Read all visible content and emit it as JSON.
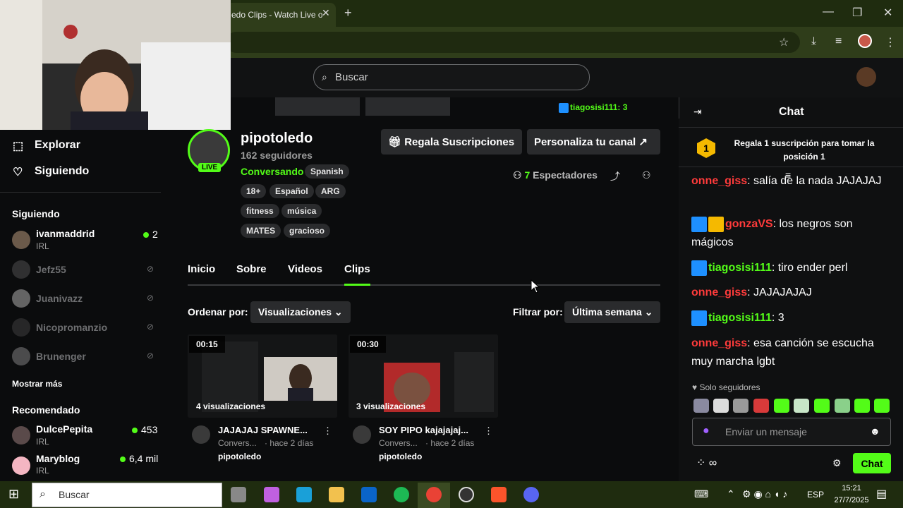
{
  "browser": {
    "tab_title": "edo Clips - Watch Live o",
    "close": "✕",
    "new_tab": "+",
    "minimize": "—",
    "maximize": "❐",
    "close_window": "✕"
  },
  "topbar": {
    "search_placeholder": "Buscar"
  },
  "sidebar": {
    "nav": [
      {
        "label": "Explorar"
      },
      {
        "label": "Siguiendo"
      }
    ],
    "following_heading": "Siguiendo",
    "following": [
      {
        "name": "ivanmaddrid",
        "category": "IRL",
        "viewers": "2",
        "live": true
      },
      {
        "name": "Jefz55",
        "live": false
      },
      {
        "name": "Juanivazz",
        "live": false
      },
      {
        "name": "Nicopromanzio",
        "live": false
      },
      {
        "name": "Brunenger",
        "live": false
      }
    ],
    "show_more": "Mostrar más",
    "recommended_heading": "Recomendado",
    "recommended": [
      {
        "name": "DulcePepita",
        "category": "IRL",
        "viewers": "453"
      },
      {
        "name": "Maryblog",
        "category": "IRL",
        "viewers": "6,4 mil"
      }
    ]
  },
  "channel": {
    "name": "pipotoledo",
    "followers": "162 seguidores",
    "live_badge": "LIVE",
    "category": "Conversando",
    "language": "Spanish",
    "tags": [
      "18+",
      "Español",
      "ARG",
      "fitness",
      "música",
      "MATES",
      "gracioso"
    ],
    "gift_button": "Regala Suscripciones",
    "customize_button": "Personaliza tu canal",
    "viewers_count": "7",
    "viewers_label": "Espectadores"
  },
  "tabs": [
    "Inicio",
    "Sobre",
    "Videos",
    "Clips"
  ],
  "filters": {
    "order_label": "Ordenar por:",
    "order_value": "Visualizaciones",
    "filter_label": "Filtrar por:",
    "filter_value": "Última semana"
  },
  "clips": [
    {
      "duration": "00:15",
      "views": "4 visualizaciones",
      "title": "JAJAJAJ SPAWNE...",
      "category": "Convers...",
      "age": "· hace 2 días",
      "channel": "pipotoledo"
    },
    {
      "duration": "00:30",
      "views": "3 visualizaciones",
      "title": "SOY PIPO kajajajaj...",
      "category": "Convers...",
      "age": "· hace 2 días",
      "channel": "pipotoledo"
    }
  ],
  "chat": {
    "title": "Chat",
    "pinned_user": "tiagosisi111: 3",
    "rank": "1",
    "promo": "Regala 1 suscripción para tomar la posición 1",
    "messages": [
      {
        "user": "onne_giss",
        "text": ": salía de la nada JAJAJAJ",
        "color": "red"
      },
      {
        "user": "gonzaVS",
        "text": ": los negros son mágicos",
        "color": "red"
      },
      {
        "user": "tiagosisi111",
        "text": ": tiro ender perl",
        "color": "green"
      },
      {
        "user": "onne_giss",
        "text": ": JAJAJAJAJ",
        "color": "red"
      },
      {
        "user": "tiagosisi111",
        "text": ": 3",
        "color": "green"
      },
      {
        "user": "onne_giss",
        "text": ": esa canción se escucha muy marcha lgbt",
        "color": "red"
      }
    ],
    "followers_only": "Solo seguidores",
    "input_placeholder": "Enviar un mensaje",
    "send_button": "Chat"
  },
  "taskbar": {
    "search_placeholder": "Buscar",
    "lang": "ESP",
    "time": "15:21",
    "date": "27/7/2025"
  },
  "colors": {
    "accent": "#53fc18",
    "chrome": "#1f2c0f"
  }
}
